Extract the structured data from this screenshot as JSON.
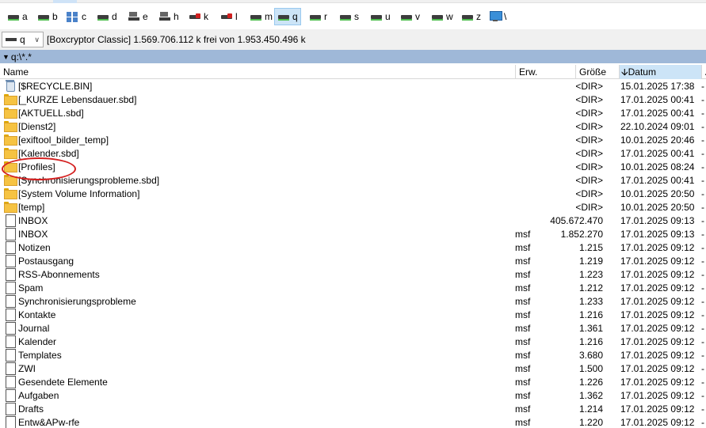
{
  "drives": [
    {
      "letter": "a",
      "icon": "hdd-icon"
    },
    {
      "letter": "b",
      "icon": "hdd-icon"
    },
    {
      "letter": "c",
      "icon": "network-drive-icon"
    },
    {
      "letter": "d",
      "icon": "hdd-icon"
    },
    {
      "letter": "e",
      "icon": "removable-drive-icon"
    },
    {
      "letter": "h",
      "icon": "removable-drive-icon"
    },
    {
      "letter": "k",
      "icon": "disconnected-drive-icon"
    },
    {
      "letter": "l",
      "icon": "disconnected-drive-icon"
    },
    {
      "letter": "m",
      "icon": "hdd-icon"
    },
    {
      "letter": "q",
      "icon": "hdd-icon",
      "active": true
    },
    {
      "letter": "r",
      "icon": "hdd-icon"
    },
    {
      "letter": "s",
      "icon": "hdd-icon"
    },
    {
      "letter": "u",
      "icon": "hdd-icon"
    },
    {
      "letter": "v",
      "icon": "hdd-icon"
    },
    {
      "letter": "w",
      "icon": "hdd-icon"
    },
    {
      "letter": "z",
      "icon": "hdd-icon"
    },
    {
      "letter": "\\",
      "icon": "network-root-icon"
    }
  ],
  "path_row": {
    "drive_value": "q",
    "info": "[Boxcryptor Classic]  1.569.706.112 k frei von 1.953.450.496 k"
  },
  "location": {
    "path": "q:\\*.*"
  },
  "columns": {
    "name": "Name",
    "ext": "Erw.",
    "size": "Größe",
    "date": "Datum",
    "attr": "A"
  },
  "sort_indicator": "down-arrow-icon",
  "rows": [
    {
      "icon": "recycle-icon",
      "name": "[$RECYCLE.BIN]",
      "ext": "",
      "size": "<DIR>",
      "date": "15.01.2025 17:38",
      "attr": "-"
    },
    {
      "icon": "folder-icon",
      "name": "[_KURZE Lebensdauer.sbd]",
      "ext": "",
      "size": "<DIR>",
      "date": "17.01.2025 00:41",
      "attr": "-"
    },
    {
      "icon": "folder-icon",
      "name": "[AKTUELL.sbd]",
      "ext": "",
      "size": "<DIR>",
      "date": "17.01.2025 00:41",
      "attr": "-"
    },
    {
      "icon": "folder-icon",
      "name": "[Dienst2]",
      "ext": "",
      "size": "<DIR>",
      "date": "22.10.2024 09:01",
      "attr": "-"
    },
    {
      "icon": "folder-icon",
      "name": "[exiftool_bilder_temp]",
      "ext": "",
      "size": "<DIR>",
      "date": "10.01.2025 20:46",
      "attr": "-"
    },
    {
      "icon": "folder-icon",
      "name": "[Kalender.sbd]",
      "ext": "",
      "size": "<DIR>",
      "date": "17.01.2025 00:41",
      "attr": "-"
    },
    {
      "icon": "folder-icon",
      "name": "[Profiles]",
      "ext": "",
      "size": "<DIR>",
      "date": "10.01.2025 08:24",
      "attr": "-"
    },
    {
      "icon": "folder-icon",
      "name": "[Synchronisierungsprobleme.sbd]",
      "ext": "",
      "size": "<DIR>",
      "date": "17.01.2025 00:41",
      "attr": "-"
    },
    {
      "icon": "folder-icon",
      "name": "[System Volume Information]",
      "ext": "",
      "size": "<DIR>",
      "date": "10.01.2025 20:50",
      "attr": "-"
    },
    {
      "icon": "folder-icon",
      "name": "[temp]",
      "ext": "",
      "size": "<DIR>",
      "date": "10.01.2025 20:50",
      "attr": "-"
    },
    {
      "icon": "file-icon",
      "name": "INBOX",
      "ext": "",
      "size": "405.672.470",
      "date": "17.01.2025 09:13",
      "attr": "-"
    },
    {
      "icon": "file-icon",
      "name": "INBOX",
      "ext": "msf",
      "size": "1.852.270",
      "date": "17.01.2025 09:13",
      "attr": "-"
    },
    {
      "icon": "file-icon",
      "name": "Notizen",
      "ext": "msf",
      "size": "1.215",
      "date": "17.01.2025 09:12",
      "attr": "-"
    },
    {
      "icon": "file-icon",
      "name": "Postausgang",
      "ext": "msf",
      "size": "1.219",
      "date": "17.01.2025 09:12",
      "attr": "-"
    },
    {
      "icon": "file-icon",
      "name": "RSS-Abonnements",
      "ext": "msf",
      "size": "1.223",
      "date": "17.01.2025 09:12",
      "attr": "-"
    },
    {
      "icon": "file-icon",
      "name": "Spam",
      "ext": "msf",
      "size": "1.212",
      "date": "17.01.2025 09:12",
      "attr": "-"
    },
    {
      "icon": "file-icon",
      "name": "Synchronisierungsprobleme",
      "ext": "msf",
      "size": "1.233",
      "date": "17.01.2025 09:12",
      "attr": "-"
    },
    {
      "icon": "file-icon",
      "name": "Kontakte",
      "ext": "msf",
      "size": "1.216",
      "date": "17.01.2025 09:12",
      "attr": "-"
    },
    {
      "icon": "file-icon",
      "name": "Journal",
      "ext": "msf",
      "size": "1.361",
      "date": "17.01.2025 09:12",
      "attr": "-"
    },
    {
      "icon": "file-icon",
      "name": "Kalender",
      "ext": "msf",
      "size": "1.216",
      "date": "17.01.2025 09:12",
      "attr": "-"
    },
    {
      "icon": "file-icon",
      "name": "Templates",
      "ext": "msf",
      "size": "3.680",
      "date": "17.01.2025 09:12",
      "attr": "-"
    },
    {
      "icon": "file-icon",
      "name": "ZWI",
      "ext": "msf",
      "size": "1.500",
      "date": "17.01.2025 09:12",
      "attr": "-"
    },
    {
      "icon": "file-icon",
      "name": "Gesendete Elemente",
      "ext": "msf",
      "size": "1.226",
      "date": "17.01.2025 09:12",
      "attr": "-"
    },
    {
      "icon": "file-icon",
      "name": "Aufgaben",
      "ext": "msf",
      "size": "1.362",
      "date": "17.01.2025 09:12",
      "attr": "-"
    },
    {
      "icon": "file-icon",
      "name": "Drafts",
      "ext": "msf",
      "size": "1.214",
      "date": "17.01.2025 09:12",
      "attr": "-"
    },
    {
      "icon": "file-icon",
      "name": "Entw&APw-rfe",
      "ext": "msf",
      "size": "1.220",
      "date": "17.01.2025 09:12",
      "attr": "-"
    }
  ],
  "annotation": {
    "type": "red-ellipse",
    "target": "[Profiles]",
    "color": "#d41f1f"
  }
}
